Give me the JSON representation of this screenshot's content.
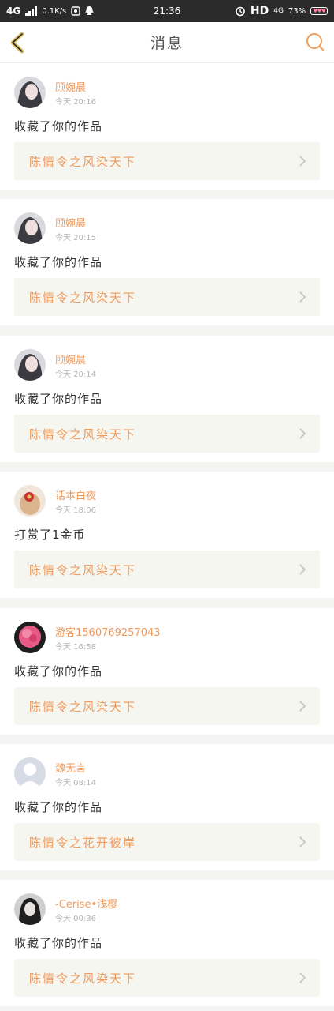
{
  "status_bar": {
    "network": "4G",
    "speed": "0.1K/s",
    "time": "21:36",
    "hd": "HD",
    "net2": "4G",
    "battery": "73%"
  },
  "header": {
    "title": "消息"
  },
  "messages": [
    {
      "name": "顾婉晨",
      "time": "今天  20:16",
      "action": "收藏了你的作品",
      "work": "陈情令之风染天下"
    },
    {
      "name": "顾婉晨",
      "time": "今天  20:15",
      "action": "收藏了你的作品",
      "work": "陈情令之风染天下"
    },
    {
      "name": "顾婉晨",
      "time": "今天  20:14",
      "action": "收藏了你的作品",
      "work": "陈情令之风染天下"
    },
    {
      "name": "话本白夜",
      "time": "今天  18:06",
      "action": "打赏了1金币",
      "work": "陈情令之风染天下"
    },
    {
      "name": "游客1560769257043",
      "time": "今天  16:58",
      "action": "收藏了你的作品",
      "work": "陈情令之风染天下"
    },
    {
      "name": "魏无言",
      "time": "今天  08:14",
      "action": "收藏了你的作品",
      "work": "陈情令之花开彼岸"
    },
    {
      "name": "-Cerise•浅樱",
      "time": "今天  00:36",
      "action": "收藏了你的作品",
      "work": "陈情令之风染天下"
    }
  ],
  "colors": {
    "accent": "#f09a5c",
    "divider": "#f4f4f2",
    "work_bg": "#f6f6f0"
  }
}
